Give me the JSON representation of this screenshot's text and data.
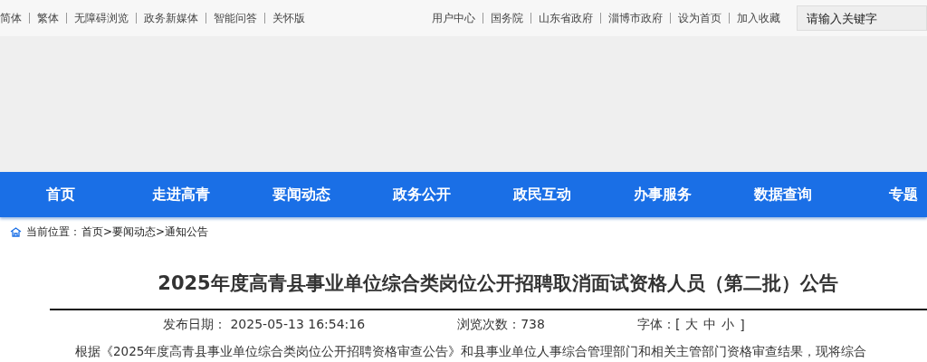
{
  "top_links_left": [
    "简体",
    "繁体",
    "无障碍浏览",
    "政务新媒体",
    "智能问答",
    "关怀版"
  ],
  "top_links_right": [
    "用户中心",
    "国务院",
    "山东省政府",
    "淄博市政府",
    "设为首页",
    "加入收藏"
  ],
  "search": {
    "placeholder": "请输入关键字"
  },
  "nav": [
    "首页",
    "走进高青",
    "要闻动态",
    "政务公开",
    "政民互动",
    "办事服务",
    "数据查询",
    "专题"
  ],
  "breadcrumb": {
    "label": "当前位置：",
    "path": "首页>要闻动态>通知公告"
  },
  "article": {
    "title": "2025年度高青县事业单位综合类岗位公开招聘取消面试资格人员（第二批）公告",
    "date_label": "发布日期：",
    "date": "2025-05-13 16:54:16",
    "views_label": "浏览次数：",
    "views": "738",
    "font_label": "字体：[",
    "font_sizes": [
      "大",
      "中",
      "小"
    ],
    "font_close": "]",
    "body": "根据《2025年度高青县事业单位综合类岗位公开招聘资格审查公告》和县事业单位人事综合管理部门和相关主管部门资格审查结果，现将综合"
  }
}
